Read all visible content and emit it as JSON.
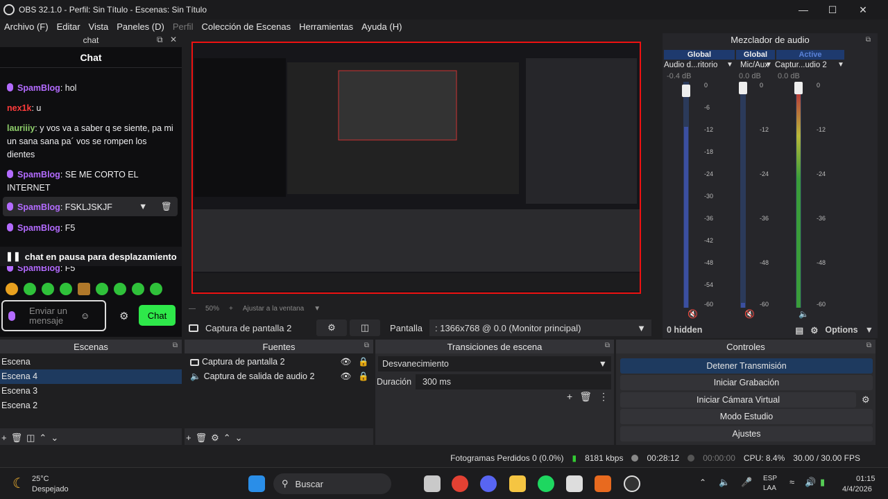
{
  "window": {
    "title": "OBS 32.1.0 - Perfil: Sin Título - Escenas: Sin Título"
  },
  "menu": [
    "Archivo (F)",
    "Editar",
    "Vista",
    "Paneles (D)",
    "Perfil",
    "Colección de Escenas",
    "Herramientas",
    "Ayuda (H)"
  ],
  "chat": {
    "dock_title": "chat",
    "header": "Chat",
    "messages": [
      {
        "user": "SpamBlog",
        "text": "hol",
        "color": "#b36bff"
      },
      {
        "user": "nex1k",
        "text": "u",
        "color": "#ff3b3b"
      },
      {
        "user": "lauriiiy",
        "text": "y vos va a saber q se siente, pa mi un sana sana pa´ vos se rompen los dientes",
        "color": "#8fd06b"
      },
      {
        "user": "SpamBlog",
        "text": "SE ME CORTO EL INTERNET",
        "color": "#b36bff"
      },
      {
        "user": "SpamBlog",
        "text": "FSKLJSKJF",
        "color": "#b36bff"
      },
      {
        "user": "SpamBlog",
        "text": "F5",
        "color": "#b36bff"
      },
      {
        "user": "SpamBlog",
        "text": "F5",
        "color": "#b36bff"
      }
    ],
    "pause_text": "chat en pausa para desplazamiento",
    "input_placeholder": "Enviar un mensaje",
    "send_label": "Chat"
  },
  "preview": {
    "zoom": "50%",
    "fit_label": "Ajustar a la ventana",
    "source_name": "Captura de pantalla 2",
    "display_label": "Pantalla",
    "display_value": ": 1366x768 @ 0.0 (Monitor principal)"
  },
  "mixer": {
    "title": "Mezclador de audio",
    "tabs": [
      "Global",
      "Global",
      "Active"
    ],
    "channels": [
      {
        "name": "Audio d...ritorio",
        "db": "-0.4 dB",
        "level": 0.8
      },
      {
        "name": "Mic/Aux",
        "db": "0.0 dB",
        "level": 0.02
      },
      {
        "name": "Captur...udio 2",
        "db": "0.0 dB",
        "level": 0.95
      }
    ],
    "ticks": [
      "0",
      "-6",
      "-12",
      "-18",
      "-24",
      "-30",
      "-36",
      "-42",
      "-48",
      "-54",
      "-60"
    ],
    "hidden": "0 hidden",
    "options": "Options"
  },
  "scenes": {
    "title": "Escenas",
    "items": [
      "Escena",
      "Escena 4",
      "Escena 3",
      "Escena 2"
    ],
    "selected": 1
  },
  "sources": {
    "title": "Fuentes",
    "items": [
      "Captura de pantalla 2",
      "Captura de salida de audio 2"
    ]
  },
  "transitions": {
    "title": "Transiciones de escena",
    "type": "Desvanecimiento",
    "duration_label": "Duración",
    "duration": "300 ms"
  },
  "controls": {
    "title": "Controles",
    "buttons": [
      "Detener Transmisión",
      "Iniciar Grabación",
      "Iniciar Cámara Virtual",
      "Modo Estudio",
      "Ajustes"
    ]
  },
  "status": {
    "dropped": "Fotogramas Perdidos 0 (0.0%)",
    "kbps": "8181 kbps",
    "live_time": "00:28:12",
    "rec_time": "00:00:00",
    "cpu": "CPU: 8.4%",
    "fps": "30.00 / 30.00 FPS"
  },
  "taskbar": {
    "temp": "25°C",
    "weather": "Despejado",
    "search": "Buscar",
    "lang": "ESP",
    "lang2": "LAA",
    "time": "01:15",
    "date": "4/4/2026"
  }
}
